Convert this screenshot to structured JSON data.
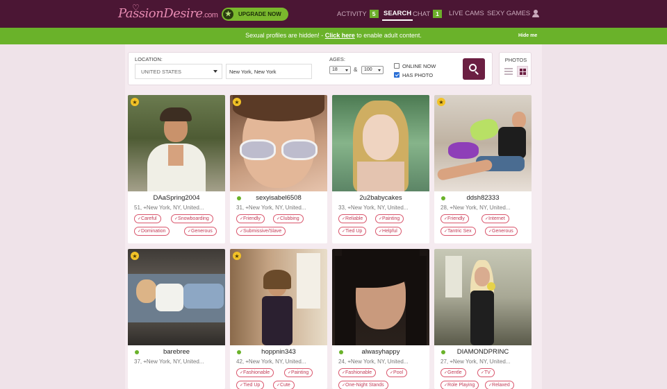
{
  "brand": {
    "name": "PassionDesire",
    "domain": ".com"
  },
  "header": {
    "upgrade_label": "UPGRADE NOW",
    "nav": [
      {
        "label": "ACTIVITY",
        "badge": "5"
      },
      {
        "label": "SEARCH",
        "badge": null
      },
      {
        "label": "CHAT",
        "badge": "1"
      },
      {
        "label": "LIVE CAMS",
        "badge": null
      },
      {
        "label": "SEXY GAMES",
        "badge": null
      }
    ]
  },
  "notice": {
    "text_before": "Sexual profiles are hidden! - ",
    "link": "Click here",
    "text_after": " to enable adult content.",
    "hide": "Hide me"
  },
  "search": {
    "location_label": "LOCATION:",
    "country": "UNITED STATES",
    "city": "New York, New York",
    "ages_label": "AGES:",
    "age_min": "18",
    "age_sep": "&",
    "age_max": "100",
    "online_now": {
      "label": "ONLINE NOW",
      "checked": false
    },
    "has_photo": {
      "label": "HAS PHOTO",
      "checked": true
    }
  },
  "view": {
    "label": "PHOTOS"
  },
  "profiles": [
    {
      "username": "DAaSpring2004",
      "age": "51",
      "location": "New York, NY, United...",
      "featured": true,
      "online": false,
      "tags": [
        "Careful",
        "Snowboarding",
        "Domination",
        "Generous"
      ]
    },
    {
      "username": "sexyisabel6508",
      "age": "31",
      "location": "New York, NY, United...",
      "featured": true,
      "online": true,
      "tags": [
        "Friendly",
        "Clubbing",
        "Submissive/Slave"
      ]
    },
    {
      "username": "2u2babycakes",
      "age": "33",
      "location": "New York, NY, United...",
      "featured": false,
      "online": false,
      "tags": [
        "Reliable",
        "Painting",
        "Tied Up",
        "Helpful"
      ]
    },
    {
      "username": "ddsh82333",
      "age": "28",
      "location": "New York, NY, United...",
      "featured": true,
      "online": true,
      "tags": [
        "Friendly",
        "Internet",
        "Tantric Sex",
        "Generous"
      ]
    },
    {
      "username": "barebree",
      "age": "37",
      "location": "New York, NY, United...",
      "featured": true,
      "online": true,
      "tags": []
    },
    {
      "username": "hoppnin343",
      "age": "42",
      "location": "New York, NY, United...",
      "featured": true,
      "online": true,
      "tags": [
        "Fashionable",
        "Painting",
        "Tied Up",
        "Cute"
      ]
    },
    {
      "username": "alwasyhappy",
      "age": "24",
      "location": "New York, NY, United...",
      "featured": false,
      "online": true,
      "tags": [
        "Fashionable",
        "Pool",
        "One-Night Stands"
      ]
    },
    {
      "username": "DIAMONDPRINC",
      "age": "27",
      "location": "New York, NY, United...",
      "featured": false,
      "online": true,
      "tags": [
        "Gentle",
        "TV",
        "Role Playing",
        "Relaxed"
      ]
    }
  ],
  "colors": {
    "topbar": "#4b1634",
    "notice": "#6ab22a",
    "accent": "#6b1f42",
    "tag": "#d9546b",
    "online": "#6ab22a",
    "star": "#f2c227"
  }
}
